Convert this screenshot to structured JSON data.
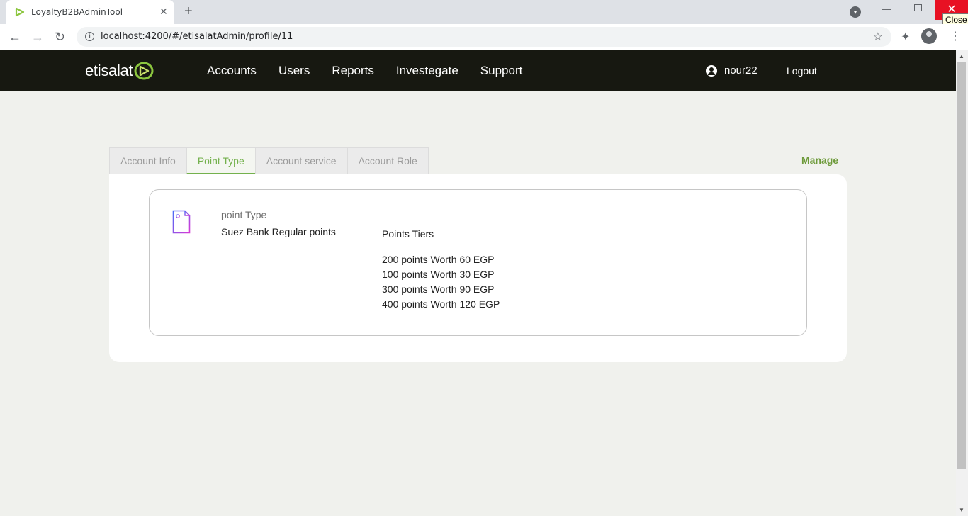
{
  "browser": {
    "tab_title": "LoyaltyB2BAdminTool",
    "url": "localhost:4200/#/etisalatAdmin/profile/11",
    "close_tooltip": "Close"
  },
  "header": {
    "brand": "etisalat",
    "brand_color": "#8cc63f",
    "nav": [
      "Accounts",
      "Users",
      "Reports",
      "Investegate",
      "Support"
    ],
    "username": "nour22",
    "logout": "Logout"
  },
  "tabs": [
    {
      "label": "Account Info",
      "active": false
    },
    {
      "label": "Point Type",
      "active": true
    },
    {
      "label": "Account service",
      "active": false
    },
    {
      "label": "Account Role",
      "active": false
    }
  ],
  "manage_label": "Manage",
  "point_type": {
    "label": "point Type",
    "value": "Suez Bank Regular points",
    "tiers_title": "Points Tiers",
    "tiers": [
      "200 points Worth 60 EGP",
      "100 points Worth 30 EGP",
      "300 points Worth 90 EGP",
      "400 points Worth 120 EGP"
    ]
  },
  "icons": {
    "document": "document-icon",
    "user": "user-circle-icon"
  }
}
